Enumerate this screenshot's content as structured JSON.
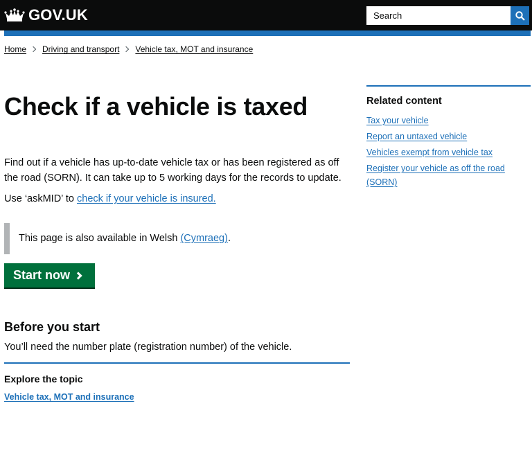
{
  "header": {
    "logo_text": "GOV.UK",
    "search_placeholder": "Search",
    "search_icon": "search-icon",
    "crown_icon": "crown-icon"
  },
  "breadcrumb": {
    "items": [
      "Home",
      "Driving and transport",
      "Vehicle tax, MOT and insurance"
    ]
  },
  "main": {
    "title": "Check if a vehicle is taxed",
    "lede": "Find out if a vehicle has up-to-date vehicle tax or has been registered as off the road (SORN). It can take up to 5 working days for the records to update.",
    "ask_prefix": "Use ‘askMID’ to ",
    "ask_link": "check if your vehicle is insured.",
    "inset_prefix": "This page is also available in Welsh ",
    "inset_link": "(Cymraeg)",
    "inset_suffix": ".",
    "start_button": "Start now",
    "before_heading": "Before you start",
    "before_text": "You’ll need the number plate (registration number) of the vehicle.",
    "explore_heading": "Explore the topic",
    "explore_link": "Vehicle tax, MOT and insurance"
  },
  "related": {
    "heading": "Related content",
    "links": [
      "Tax your vehicle",
      "Report an untaxed vehicle",
      "Vehicles exempt from vehicle tax",
      "Register your vehicle as off the road (SORN)"
    ]
  },
  "colors": {
    "header_bg": "#0b0c0c",
    "brand_blue": "#1d70b8",
    "start_green": "#00703c",
    "inset_border": "#b1b4b6"
  }
}
